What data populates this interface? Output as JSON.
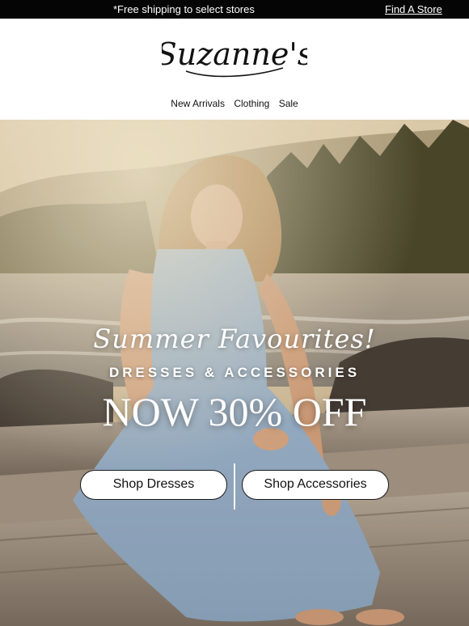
{
  "topbar": {
    "promo_text": "*Free shipping to select stores",
    "store_link": "Find A Store"
  },
  "brand": {
    "logo_text": "Suzanne's"
  },
  "nav": {
    "items": [
      "New Arrivals",
      "Clothing",
      "Sale"
    ]
  },
  "hero": {
    "script_title": "Summer Favourites!",
    "subtitle": "DRESSES & ACCESSORIES",
    "offer": "NOW 30% OFF",
    "buttons": {
      "dresses": "Shop Dresses",
      "accessories": "Shop Accessories"
    }
  },
  "colors": {
    "topbar_bg": "#050505",
    "button_bg": "#ffffff",
    "button_border": "#1a1a1a",
    "headline_text": "#ffffff"
  }
}
